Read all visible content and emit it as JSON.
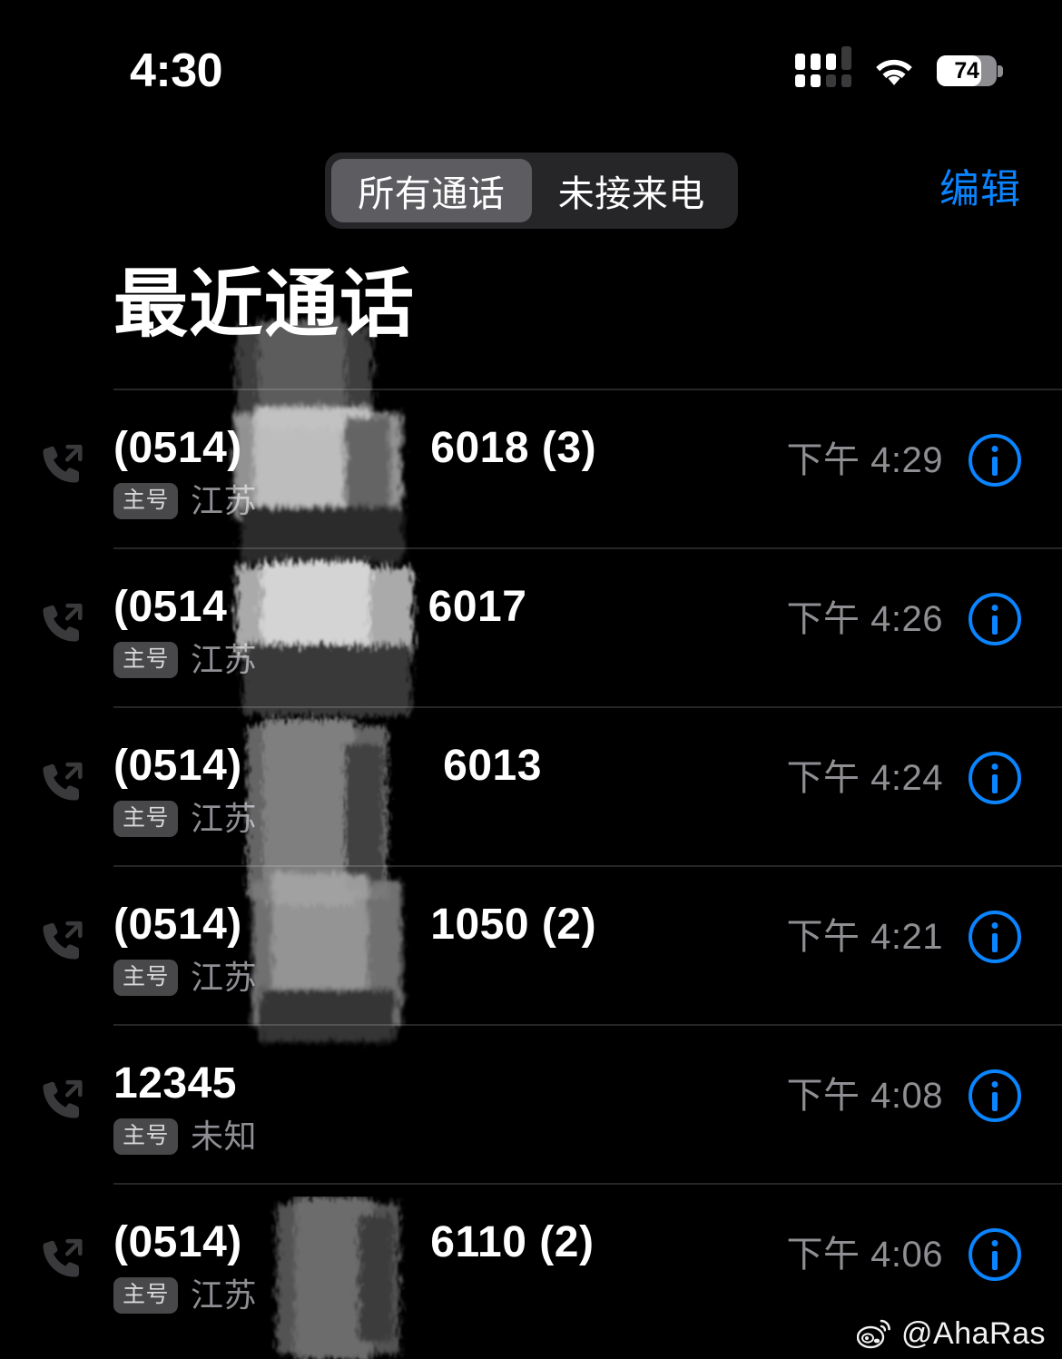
{
  "status_bar": {
    "time": "4:30",
    "battery_percent": "74",
    "signal_icon": "cellular-signal-icon",
    "wifi_icon": "wifi-icon",
    "battery_icon": "battery-icon"
  },
  "nav": {
    "segments": [
      {
        "label": "所有通话",
        "selected": true
      },
      {
        "label": "未接来电",
        "selected": false
      }
    ],
    "edit_label": "编辑"
  },
  "page_title": "最近通话",
  "calls": [
    {
      "number": "(0514)               6018 (3)",
      "sim_badge": "主号",
      "location": "江苏",
      "time": "下午 4:29",
      "call_type_icon": "outgoing-call-icon",
      "info_icon": "info-circle-icon"
    },
    {
      "number": "(0514                6017",
      "sim_badge": "主号",
      "location": "江苏",
      "time": "下午 4:26",
      "call_type_icon": "outgoing-call-icon",
      "info_icon": "info-circle-icon"
    },
    {
      "number": "(0514)                6013",
      "sim_badge": "主号",
      "location": "江苏",
      "time": "下午 4:24",
      "call_type_icon": "outgoing-call-icon",
      "info_icon": "info-circle-icon"
    },
    {
      "number": "(0514)               1050 (2)",
      "sim_badge": "主号",
      "location": "江苏",
      "time": "下午 4:21",
      "call_type_icon": "outgoing-call-icon",
      "info_icon": "info-circle-icon"
    },
    {
      "number": "12345",
      "sim_badge": "主号",
      "location": "未知",
      "time": "下午 4:08",
      "call_type_icon": "outgoing-call-icon",
      "info_icon": "info-circle-icon"
    },
    {
      "number": "(0514)               6110 (2)",
      "sim_badge": "主号",
      "location": "江苏",
      "time": "下午 4:06",
      "call_type_icon": "outgoing-call-icon",
      "info_icon": "info-circle-icon"
    }
  ],
  "watermark": {
    "handle": "@AhaRas",
    "logo_icon": "weibo-logo-icon"
  },
  "colors": {
    "background": "#000000",
    "accent_blue": "#0a84ff",
    "secondary_text": "#8e8e93",
    "separator": "#262628",
    "segment_track": "#262628",
    "segment_selected": "#5c5c61",
    "sim_badge_bg": "#48484a",
    "call_icon": "#3a3a3c"
  }
}
